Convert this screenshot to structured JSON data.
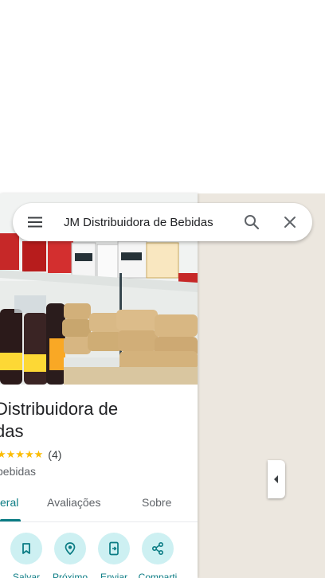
{
  "search": {
    "query": "JM Distribuidora de Bebidas"
  },
  "place": {
    "title_line1": "Distribuidora de",
    "title_line2": "das",
    "rating_stars": "★★★★★",
    "rating_count": "(4)",
    "category": "bebidas"
  },
  "tabs": [
    {
      "label": "eral"
    },
    {
      "label": "Avaliações"
    },
    {
      "label": "Sobre"
    }
  ],
  "actions": [
    {
      "label": "Salvar"
    },
    {
      "label": "Próximo"
    },
    {
      "label": "Enviar"
    },
    {
      "label": "Comparti"
    }
  ],
  "colors": {
    "accent": "#0b7c84",
    "action_bg": "#cdf0f2",
    "map_bg": "#ece7df",
    "star": "#fbbc04"
  },
  "icons": [
    "menu-icon",
    "search-icon",
    "close-icon",
    "bookmark-icon",
    "nearby-icon",
    "send-to-phone-icon",
    "share-icon",
    "collapse-arrow-icon"
  ]
}
